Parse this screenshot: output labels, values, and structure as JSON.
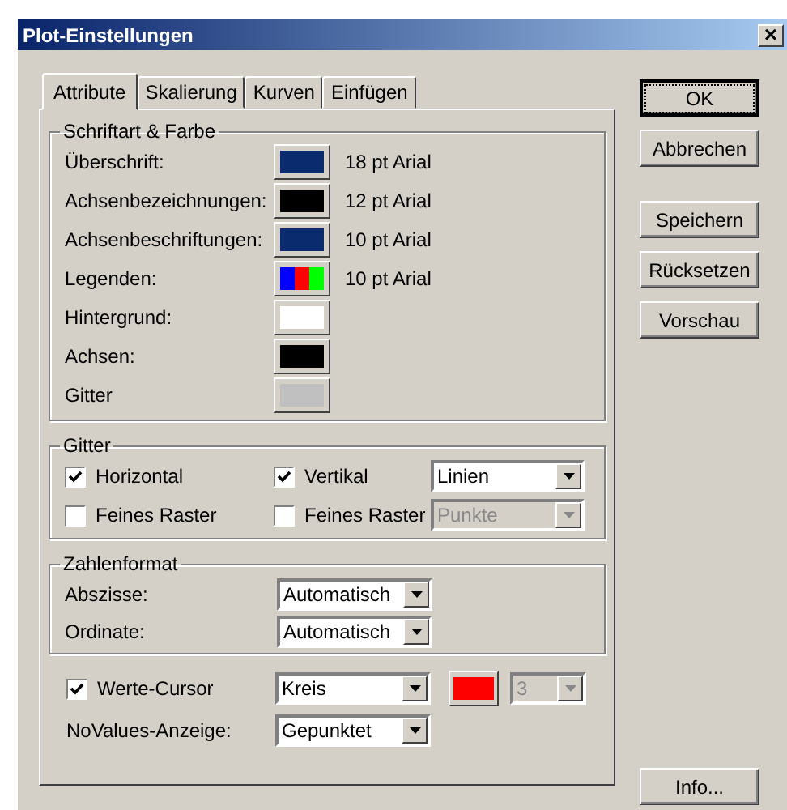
{
  "window": {
    "title": "Plot-Einstellungen",
    "close": "×"
  },
  "tabs": [
    {
      "label": "Attribute",
      "selected": true
    },
    {
      "label": "Skalierung",
      "selected": false
    },
    {
      "label": "Kurven",
      "selected": false
    },
    {
      "label": "Einfügen",
      "selected": false
    }
  ],
  "font_color": {
    "title": "Schriftart & Farbe",
    "rows": [
      {
        "label": "Überschrift:",
        "kind": "solid",
        "color": "#0a2b6e",
        "font": "18 pt Arial"
      },
      {
        "label": "Achsenbezeichnungen:",
        "kind": "solid",
        "color": "#000000",
        "font": "12 pt Arial"
      },
      {
        "label": "Achsenbeschriftungen:",
        "kind": "solid",
        "color": "#0a2b6e",
        "font": "10 pt Arial"
      },
      {
        "label": "Legenden:",
        "kind": "multi",
        "segments": [
          {
            "color": "#0000ff"
          },
          {
            "color": "#ff0000"
          },
          {
            "color": "#00ff00"
          }
        ],
        "font": "10 pt Arial"
      },
      {
        "label": "Hintergrund:",
        "kind": "solid",
        "color": "#ffffff"
      },
      {
        "label": "Achsen:",
        "kind": "solid",
        "color": "#000000"
      },
      {
        "label": "Gitter",
        "kind": "solid",
        "color": "#c0c0c0"
      }
    ]
  },
  "grid": {
    "title": "Gitter",
    "rows": [
      {
        "left": {
          "label": "Horizontal",
          "checked": true
        },
        "right": {
          "label": "Vertikal",
          "checked": true
        },
        "dropdown": {
          "value": "Linien",
          "disabled": false
        }
      },
      {
        "left": {
          "label": "Feines Raster",
          "checked": false
        },
        "right": {
          "label": "Feines Raster",
          "checked": false
        },
        "dropdown": {
          "value": "Punkte",
          "disabled": true
        }
      }
    ]
  },
  "number_format": {
    "title": "Zahlenformat",
    "rows": [
      {
        "label": "Abszisse:",
        "value": "Automatisch"
      },
      {
        "label": "Ordinate:",
        "value": "Automatisch"
      }
    ]
  },
  "cursor": {
    "label": "Werte-Cursor",
    "checked": true,
    "shape": "Kreis",
    "color": "#ff0000",
    "size": {
      "value": "3",
      "disabled": true
    }
  },
  "novalues": {
    "label": "NoValues-Anzeige:",
    "value": "Gepunktet"
  },
  "buttons": [
    {
      "label": "OK",
      "default": true
    },
    {
      "label": "Abbrechen",
      "default": false
    },
    {
      "label": "Speichern",
      "default": false
    },
    {
      "label": "Rücksetzen",
      "default": false
    },
    {
      "label": "Vorschau",
      "default": false
    },
    {
      "label": "Info...",
      "default": false
    }
  ]
}
